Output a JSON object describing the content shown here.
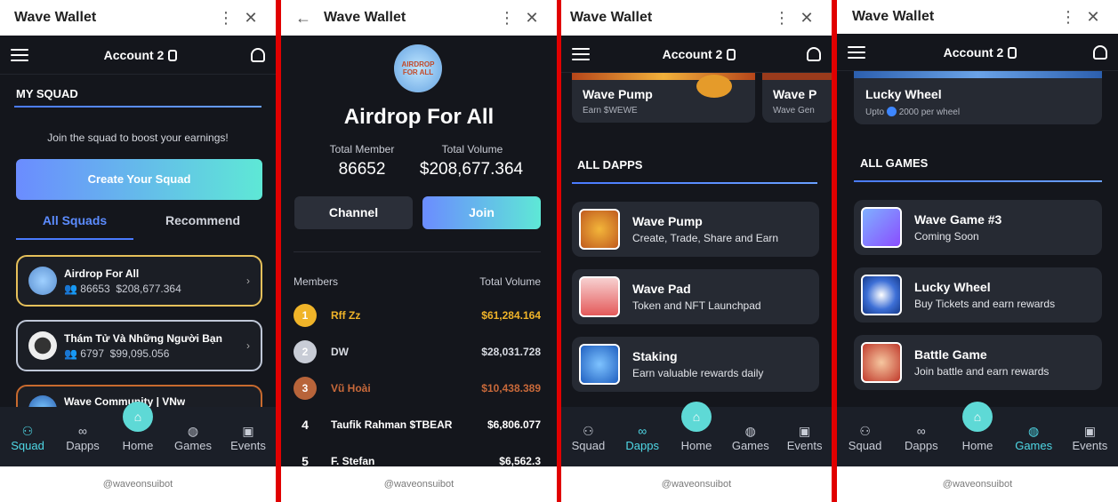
{
  "window_title": "Wave Wallet",
  "footer_text": "@waveonsuibot",
  "account_name": "Account 2",
  "nav": {
    "squad": "Squad",
    "dapps": "Dapps",
    "home": "Home",
    "games": "Games",
    "events": "Events"
  },
  "screen1": {
    "section_title": "MY SQUAD",
    "join_text": "Join the squad to boost your earnings!",
    "create_button": "Create Your Squad",
    "tab_all": "All Squads",
    "tab_recommend": "Recommend",
    "squads": [
      {
        "name": "Airdrop For All",
        "members": "86653",
        "volume": "$208,677.364"
      },
      {
        "name": "Thám Tử Và Những Người Bạn",
        "members": "6797",
        "volume": "$99,095.056"
      },
      {
        "name": "Wave Community | VNw",
        "members": "",
        "volume": ""
      }
    ]
  },
  "screen2": {
    "squad_name": "Airdrop For All",
    "logo_text": "AIRDROP FOR ALL",
    "total_member_label": "Total Member",
    "total_member_value": "86652",
    "total_volume_label": "Total Volume",
    "total_volume_value": "$208,677.364",
    "channel_button": "Channel",
    "join_button": "Join",
    "members_header": "Members",
    "volume_header": "Total Volume",
    "members": [
      {
        "rank": "1",
        "name": "Rff Zz",
        "volume": "$61,284.164",
        "color": "#f0b429"
      },
      {
        "rank": "2",
        "name": "DW",
        "volume": "$28,031.728",
        "color": "#d8dbe2"
      },
      {
        "rank": "3",
        "name": "Vũ Hoài",
        "volume": "$10,438.389",
        "color": "#c8693a"
      },
      {
        "rank": "4",
        "name": "Taufik Rahman $TBEAR",
        "volume": "$6,806.077",
        "color": "#ffffff"
      },
      {
        "rank": "5",
        "name": "F. Stefan",
        "volume": "$6,562.3",
        "color": "#ffffff"
      }
    ]
  },
  "screen3": {
    "featured": [
      {
        "name": "Wave Pump",
        "sub": "Earn $WEWE"
      },
      {
        "name": "Wave P",
        "sub": "Wave Gen"
      }
    ],
    "section_title": "ALL DAPPS",
    "dapps": [
      {
        "name": "Wave Pump",
        "desc": "Create, Trade, Share and Earn",
        "icon": "wave-pump-icon"
      },
      {
        "name": "Wave Pad",
        "desc": "Token and NFT Launchpad",
        "icon": "rocket-icon"
      },
      {
        "name": "Staking",
        "desc": "Earn valuable rewards daily",
        "icon": "coin-stack-icon"
      }
    ]
  },
  "screen4": {
    "featured_name": "Lucky Wheel",
    "featured_sub_prefix": "Upto",
    "featured_sub_value": "2000 per wheel",
    "section_title": "ALL GAMES",
    "games": [
      {
        "name": "Wave Game #3",
        "desc": "Coming Soon",
        "icon": "gamepad-icon"
      },
      {
        "name": "Lucky Wheel",
        "desc": "Buy Tickets and earn rewards",
        "icon": "lucky-wheel-icon"
      },
      {
        "name": "Battle Game",
        "desc": "Join battle and earn rewards",
        "icon": "pirate-icon"
      }
    ]
  },
  "colors": {
    "accent_gradient_start": "#6b8cff",
    "accent_gradient_end": "#5ee8d6",
    "active_nav": "#4fd8e6",
    "gold": "#f0b429",
    "bronze": "#c8693a",
    "separator": "#e10000"
  }
}
